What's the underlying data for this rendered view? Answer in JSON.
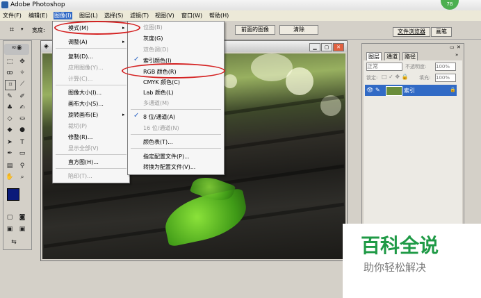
{
  "window": {
    "title": "Adobe Photoshop",
    "badge": "78"
  },
  "menubar": [
    "文件(F)",
    "编辑(E)",
    "图像(I)",
    "图层(L)",
    "选择(S)",
    "滤镜(T)",
    "视图(V)",
    "窗口(W)",
    "帮助(H)"
  ],
  "options_bar": {
    "width_label": "宽度:",
    "front_image_button": "前面的图像",
    "clear_button": "清除"
  },
  "panel_tabs": {
    "file_browser": "文件浏览器",
    "brushes": "画笔"
  },
  "image_menu": {
    "items": [
      {
        "label": "模式(M)",
        "disabled": false,
        "submenu": true
      },
      {
        "label": "调整(A)",
        "disabled": false,
        "submenu": true
      },
      {
        "label": "复制(D)...",
        "disabled": false
      },
      {
        "label": "应用图像(Y)...",
        "disabled": true
      },
      {
        "label": "计算(C)...",
        "disabled": true
      },
      {
        "label": "图像大小(I)...",
        "disabled": false
      },
      {
        "label": "画布大小(S)...",
        "disabled": false
      },
      {
        "label": "旋转画布(E)",
        "disabled": false,
        "submenu": true
      },
      {
        "label": "裁切(P)",
        "disabled": true
      },
      {
        "label": "修整(R)...",
        "disabled": false
      },
      {
        "label": "显示全部(V)",
        "disabled": true
      },
      {
        "label": "直方图(H)...",
        "disabled": false
      },
      {
        "label": "陷印(T)...",
        "disabled": true
      }
    ]
  },
  "mode_submenu": {
    "items": [
      {
        "label": "位图(B)",
        "disabled": true,
        "checked": false
      },
      {
        "label": "灰度(G)",
        "disabled": false,
        "checked": false
      },
      {
        "label": "双色调(D)",
        "disabled": true,
        "checked": false
      },
      {
        "label": "索引颜色(I)",
        "disabled": false,
        "checked": true
      },
      {
        "label": "RGB 颜色(R)",
        "disabled": false,
        "checked": false
      },
      {
        "label": "CMYK 颜色(C)",
        "disabled": false,
        "checked": false
      },
      {
        "label": "Lab 颜色(L)",
        "disabled": false,
        "checked": false
      },
      {
        "label": "多通道(M)",
        "disabled": true,
        "checked": false
      },
      {
        "label": "8 位/通道(A)",
        "disabled": false,
        "checked": true
      },
      {
        "label": "16 位/通道(N)",
        "disabled": true,
        "checked": false
      },
      {
        "label": "颜色表(T)...",
        "disabled": false,
        "checked": false
      },
      {
        "label": "指定配置文件(P)...",
        "disabled": false,
        "checked": false
      },
      {
        "label": "转换为配置文件(V)...",
        "disabled": false,
        "checked": false
      }
    ]
  },
  "layers_panel": {
    "tabs": [
      "图层",
      "通道",
      "路径"
    ],
    "blend_mode": "正常",
    "opacity_label": "不透明度:",
    "opacity": "100%",
    "lock_label": "锁定:",
    "fill_label": "填充:",
    "fill": "100%",
    "layer_name": "索引"
  },
  "watermark": {
    "main": "百科全说",
    "sub": "助你轻松解决"
  },
  "colors": {
    "accent_red": "#d42020",
    "selection_blue": "#316ac5",
    "watermark_green": "#1f9a46",
    "foreground": "#0a1a7a"
  }
}
